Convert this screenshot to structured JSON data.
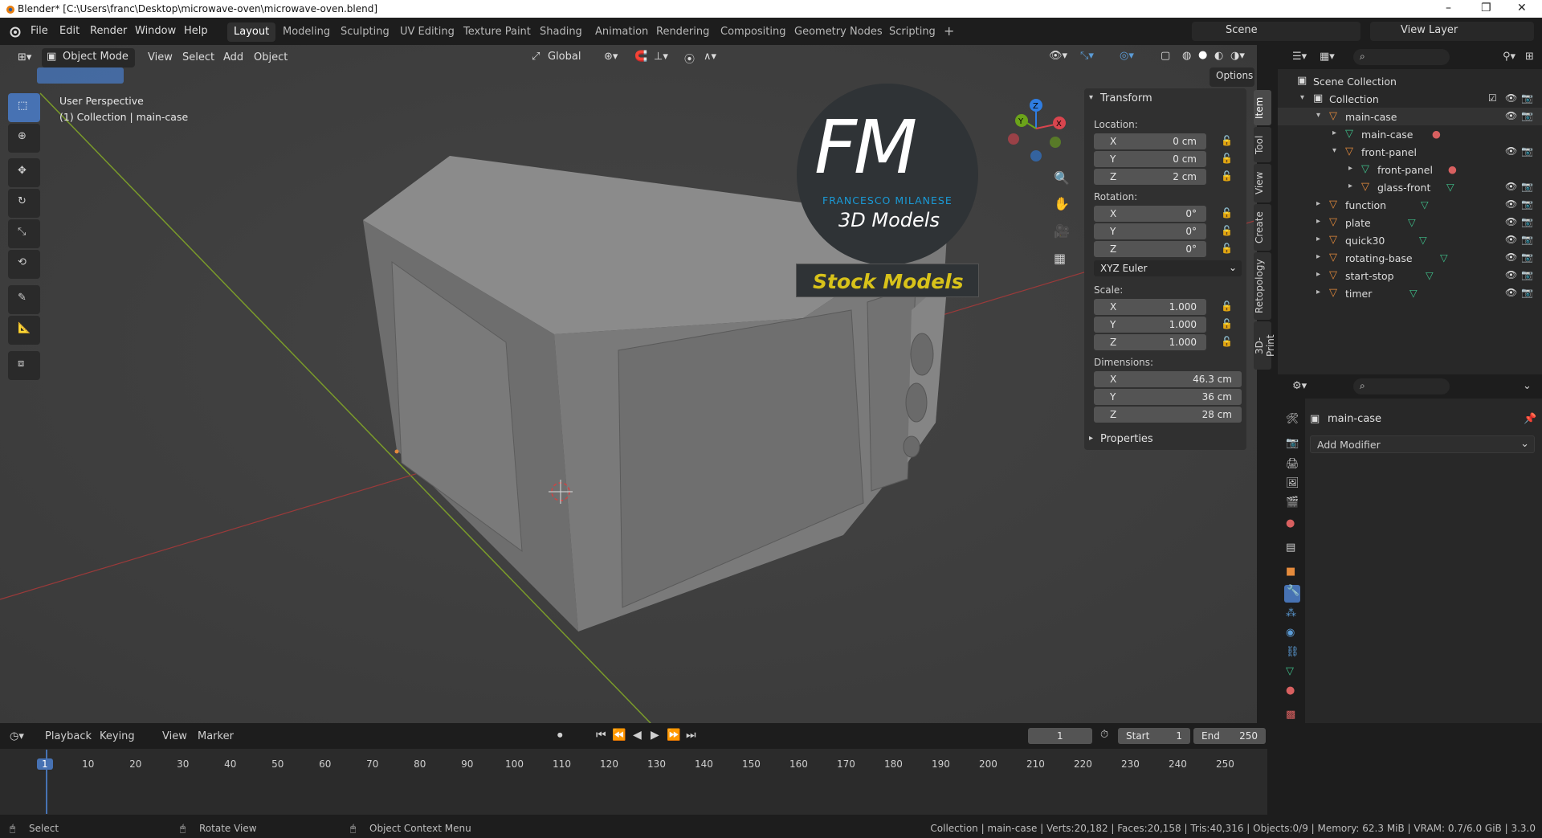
{
  "window": {
    "title": "Blender* [C:\\Users\\franc\\Desktop\\microwave-oven\\microwave-oven.blend]",
    "controls": [
      "–",
      "❐",
      "✕"
    ]
  },
  "menu": [
    "File",
    "Edit",
    "Render",
    "Window",
    "Help"
  ],
  "workspaces": [
    "Layout",
    "Modeling",
    "Sculpting",
    "UV Editing",
    "Texture Paint",
    "Shading",
    "Animation",
    "Rendering",
    "Compositing",
    "Geometry Nodes",
    "Scripting",
    "+"
  ],
  "scene": {
    "name": "Scene",
    "view_layer": "View Layer"
  },
  "viewport_header": {
    "mode": "Object Mode",
    "menus": [
      "View",
      "Select",
      "Add",
      "Object"
    ],
    "orientation": "Global",
    "options": "Options"
  },
  "viewport": {
    "line1": "User Perspective",
    "line2": "(1) Collection | main-case",
    "gizmo": {
      "x": "X",
      "y": "Y",
      "z": "Z"
    }
  },
  "watermark": {
    "logo": "FM",
    "brand": "FRANCESCO MILANESE",
    "sub": "3D Models",
    "banner": "Stock Models"
  },
  "npanel": {
    "header": "Transform",
    "location_label": "Location:",
    "location": [
      {
        "axis": "X",
        "value": "0 cm"
      },
      {
        "axis": "Y",
        "value": "0 cm"
      },
      {
        "axis": "Z",
        "value": "2 cm"
      }
    ],
    "rotation_label": "Rotation:",
    "rotation": [
      {
        "axis": "X",
        "value": "0°"
      },
      {
        "axis": "Y",
        "value": "0°"
      },
      {
        "axis": "Z",
        "value": "0°"
      }
    ],
    "rotation_mode": "XYZ Euler",
    "scale_label": "Scale:",
    "scale": [
      {
        "axis": "X",
        "value": "1.000"
      },
      {
        "axis": "Y",
        "value": "1.000"
      },
      {
        "axis": "Z",
        "value": "1.000"
      }
    ],
    "dimensions_label": "Dimensions:",
    "dimensions": [
      {
        "axis": "X",
        "value": "46.3 cm"
      },
      {
        "axis": "Y",
        "value": "36 cm"
      },
      {
        "axis": "Z",
        "value": "28 cm"
      }
    ],
    "properties": "Properties",
    "tabs": [
      "Item",
      "Tool",
      "View",
      "Create",
      "Retopology",
      "3D-Print"
    ]
  },
  "outliner": {
    "rows": [
      {
        "name": "Scene Collection"
      },
      {
        "name": "Collection"
      },
      {
        "name": "main-case"
      },
      {
        "name": "main-case"
      },
      {
        "name": "front-panel"
      },
      {
        "name": "front-panel"
      },
      {
        "name": "glass-front"
      },
      {
        "name": "function"
      },
      {
        "name": "plate"
      },
      {
        "name": "quick30"
      },
      {
        "name": "rotating-base"
      },
      {
        "name": "start-stop"
      },
      {
        "name": "timer"
      }
    ]
  },
  "properties": {
    "object": "main-case",
    "add_modifier": "Add Modifier"
  },
  "timeline": {
    "menus": [
      "Playback",
      "Keying",
      "View",
      "Marker"
    ],
    "current": "1",
    "start_label": "Start",
    "start": "1",
    "end_label": "End",
    "end": "250",
    "ticks": [
      "1",
      "10",
      "20",
      "30",
      "40",
      "50",
      "60",
      "70",
      "80",
      "90",
      "100",
      "110",
      "120",
      "130",
      "140",
      "150",
      "160",
      "170",
      "180",
      "190",
      "200",
      "210",
      "220",
      "230",
      "240",
      "250"
    ]
  },
  "statusbar": {
    "select": "Select",
    "rotate": "Rotate View",
    "context": "Object Context Menu",
    "stats": "Collection | main-case | Verts:20,182 | Faces:20,158 | Tris:40,316 | Objects:0/9 | Memory: 62.3 MiB | VRAM: 0.7/6.0 GiB | 3.3.0"
  },
  "colors": {
    "accent": "#4772b3",
    "brand_blue": "#1a9ad6",
    "banner_text": "#d8c21a",
    "object_orange": "#e58b3c",
    "mesh_green": "#3fbf8a"
  }
}
